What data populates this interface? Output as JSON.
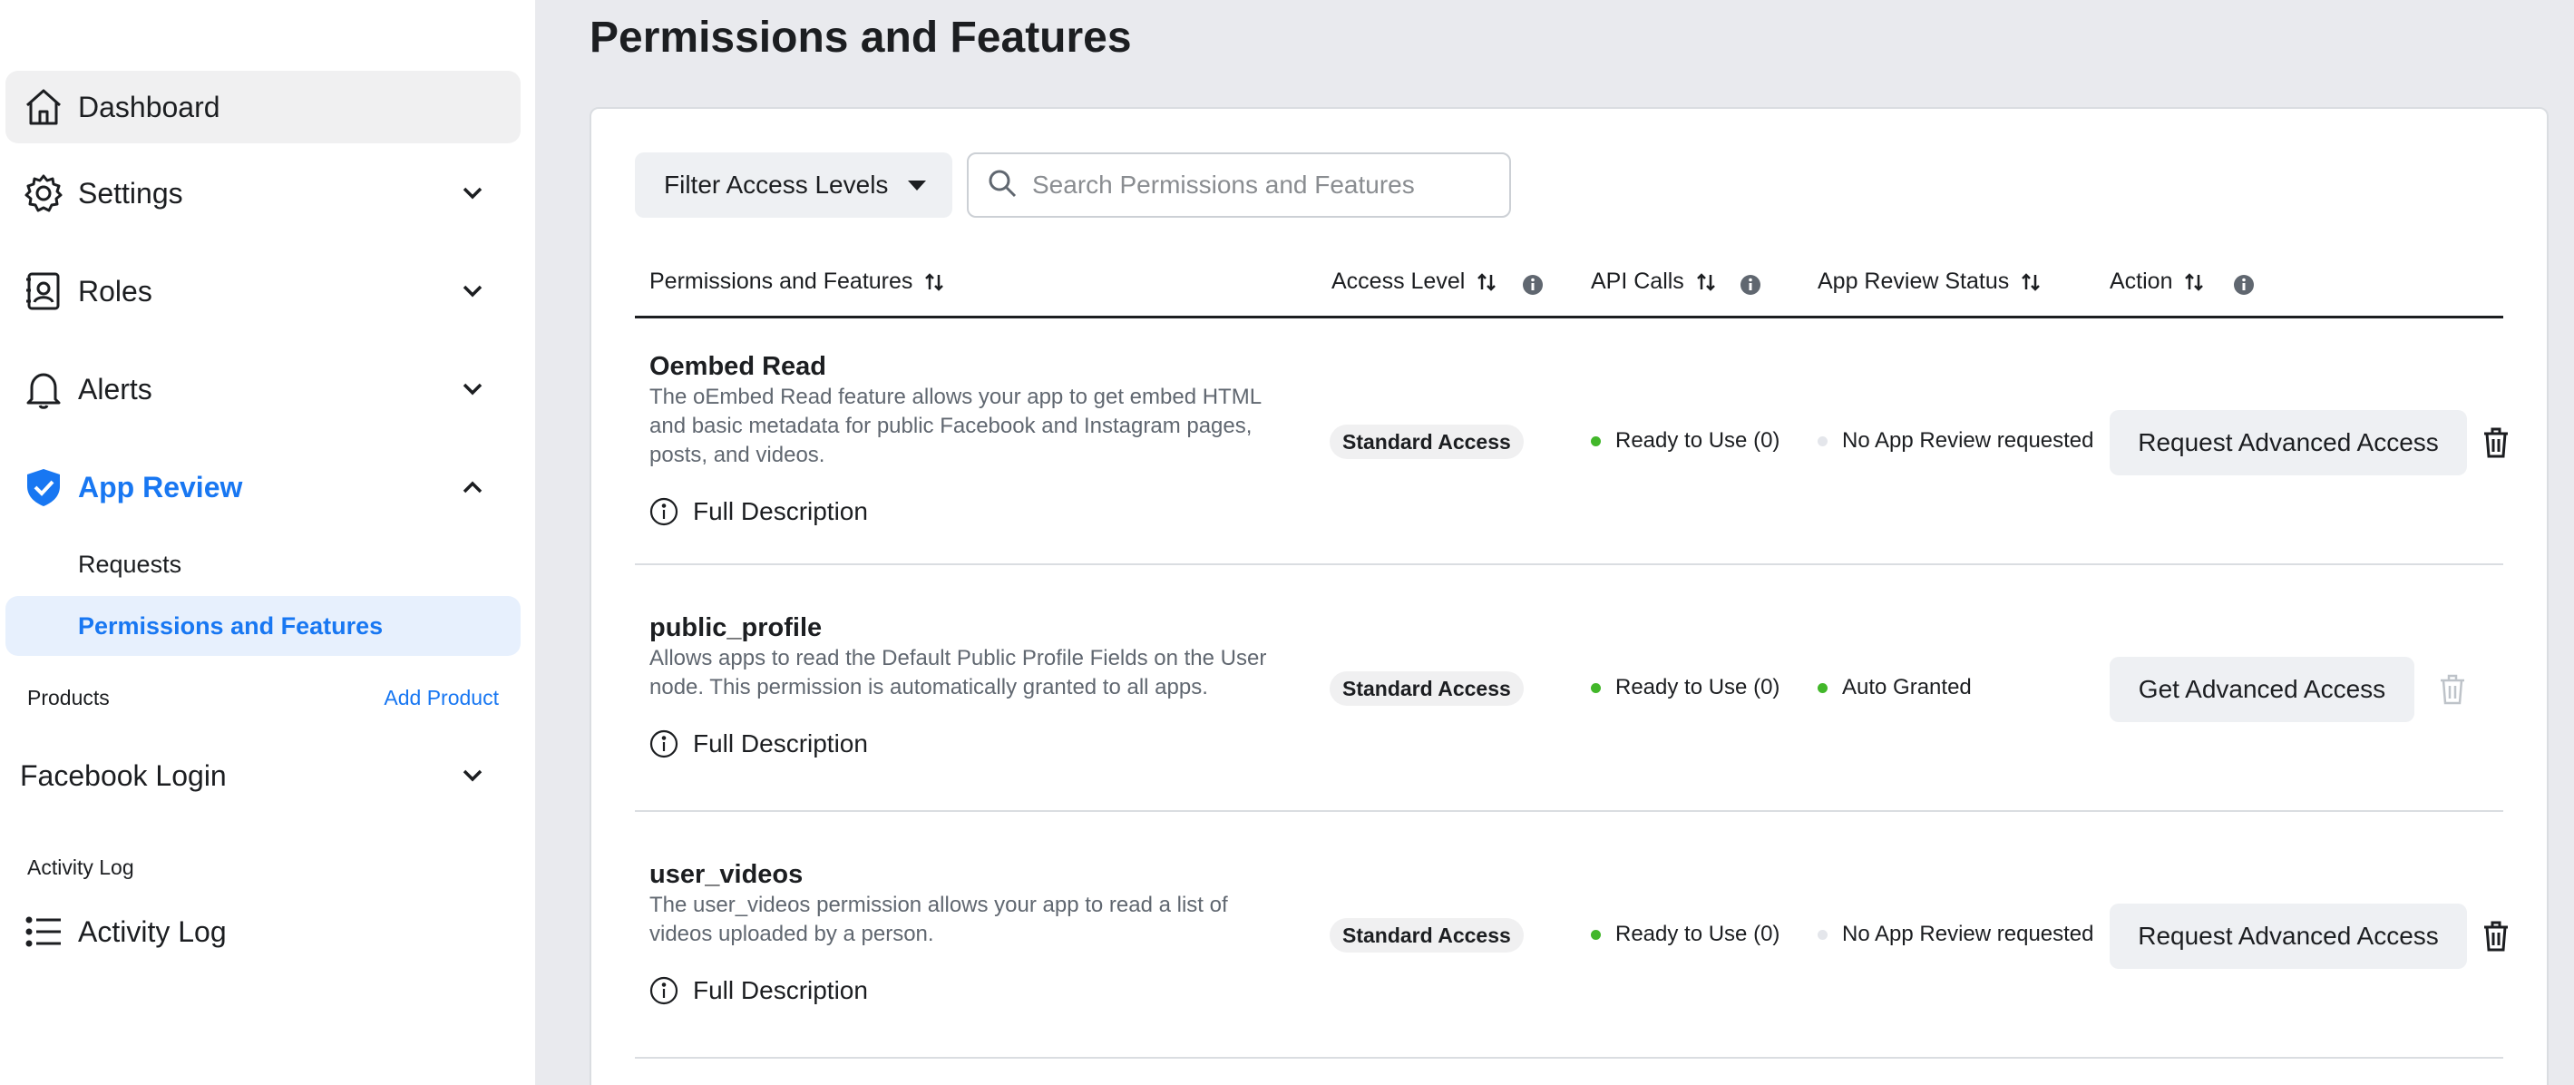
{
  "sidebar": {
    "items": [
      {
        "label": "Dashboard",
        "icon": "home-icon"
      },
      {
        "label": "Settings",
        "icon": "gear-icon"
      },
      {
        "label": "Roles",
        "icon": "id-card-icon"
      },
      {
        "label": "Alerts",
        "icon": "bell-icon"
      },
      {
        "label": "App Review",
        "icon": "shield-check-icon"
      }
    ],
    "app_review_sub": [
      {
        "label": "Requests"
      },
      {
        "label": "Permissions and Features"
      }
    ],
    "products_label": "Products",
    "add_product_label": "Add Product",
    "facebook_login_label": "Facebook Login",
    "activity_section_label": "Activity Log",
    "activity_item_label": "Activity Log"
  },
  "main": {
    "title": "Permissions and Features",
    "filter_label": "Filter Access Levels",
    "search_placeholder": "Search Permissions and Features",
    "columns": [
      "Permissions and Features",
      "Access Level",
      "API Calls",
      "App Review Status",
      "Action"
    ],
    "full_description_label": "Full Description",
    "rows": [
      {
        "name": "Oembed Read",
        "description": "The oEmbed Read feature allows your app to get embed HTML and basic metadata for public Facebook and Instagram pages, posts, and videos.",
        "access_level": "Standard Access",
        "api_calls": "Ready to Use (0)",
        "review_status": "No App Review requested",
        "action": "Request Advanced Access"
      },
      {
        "name": "public_profile",
        "description": "Allows apps to read the Default Public Profile Fields on the User node. This permission is automatically granted to all apps.",
        "access_level": "Standard Access",
        "api_calls": "Ready to Use (0)",
        "review_status": "Auto Granted",
        "action": "Get Advanced Access"
      },
      {
        "name": "user_videos",
        "description": "The user_videos permission allows your app to read a list of videos uploaded by a person.",
        "access_level": "Standard Access",
        "api_calls": "Ready to Use (0)",
        "review_status": "No App Review requested",
        "action": "Request Advanced Access"
      }
    ]
  },
  "colors": {
    "accent": "#1877f2",
    "status_green": "#42b72a",
    "status_grey": "#e4e6eb"
  }
}
